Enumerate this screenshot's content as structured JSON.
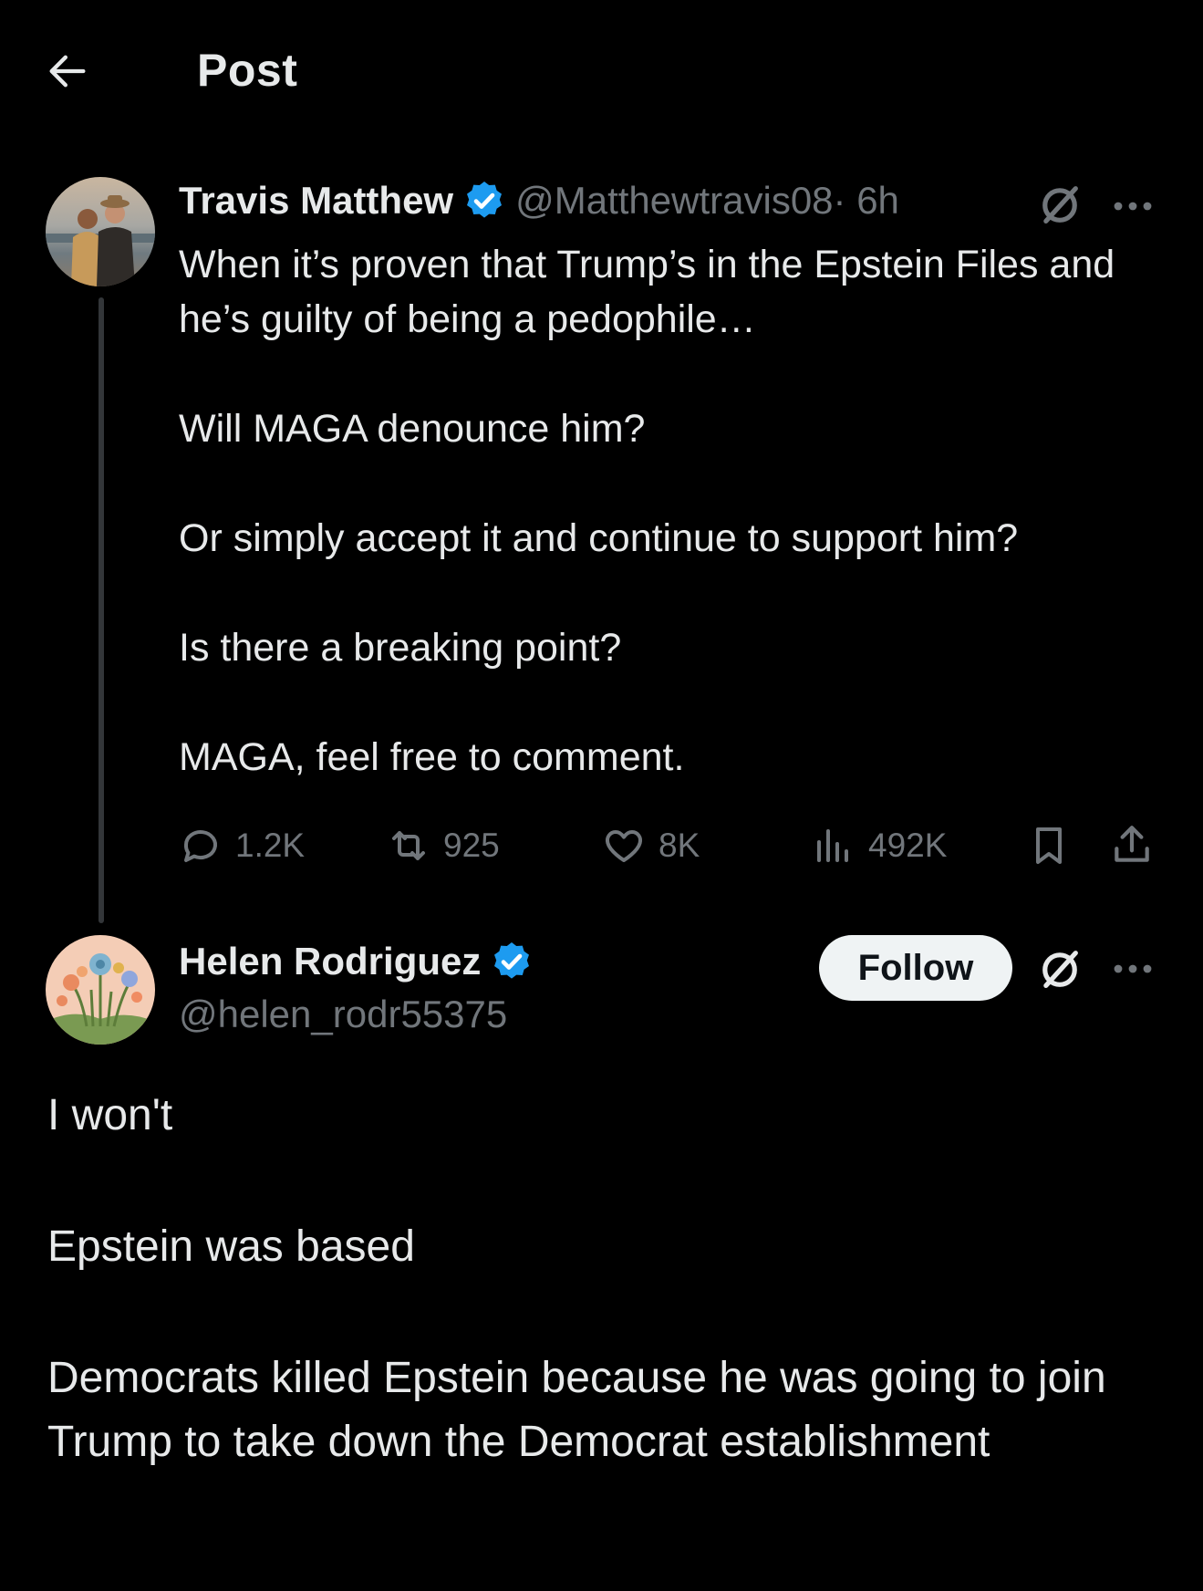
{
  "header": {
    "title": "Post",
    "back_icon": "arrow-left-icon"
  },
  "original_post": {
    "author_name": "Travis Matthew",
    "handle": "@Matthewtravis08",
    "time": " · 6h",
    "verified_color": "#1d9bf0",
    "paragraphs": [
      "When it’s proven that Trump’s in the Epstein Files and he’s guilty of being a pedophile…",
      "Will MAGA denounce him?",
      "Or simply accept it and continue to support him?",
      "Is there a breaking point?",
      "MAGA, feel free to comment."
    ],
    "stats": {
      "replies": "1.2K",
      "reposts": "925",
      "likes": "8K",
      "views": "492K"
    }
  },
  "reply_post": {
    "author_name": "Helen Rodriguez",
    "handle": "@helen_rodr55375",
    "follow_label": "Follow",
    "paragraphs": [
      "I won't",
      "Epstein was based",
      "Democrats killed Epstein because he was going to join Trump to take down the Democrat establishment"
    ]
  },
  "colors": {
    "background": "#000000",
    "text": "#e7e9ea",
    "muted": "#71767b",
    "accent": "#1d9bf0"
  }
}
